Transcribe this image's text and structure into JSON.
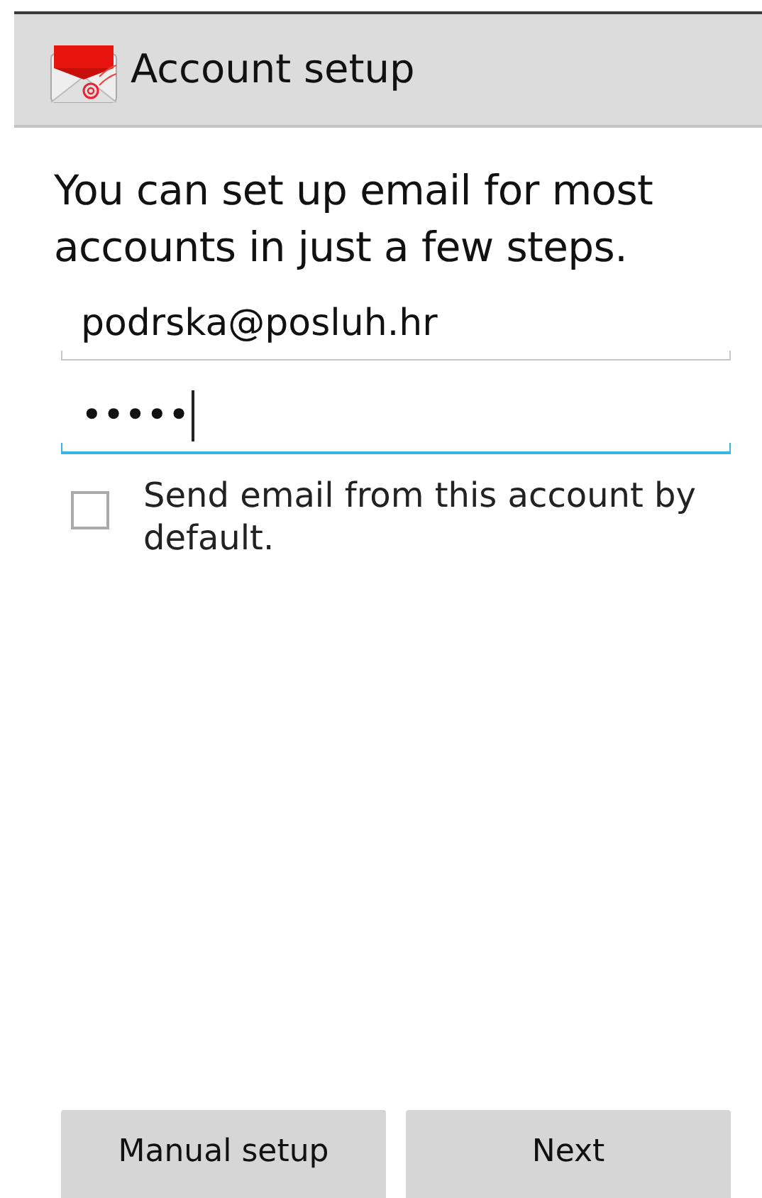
{
  "action_bar": {
    "title": "Account setup"
  },
  "intro": "You can set up email for most accounts in just a few steps.",
  "email_field": {
    "value": "podrska@posluh.hr",
    "focused": false
  },
  "password_field": {
    "value": "•••••",
    "focused": true
  },
  "default_account": {
    "label": "Send email from this account by default.",
    "checked": false
  },
  "buttons": [
    {
      "label": "Manual setup"
    },
    {
      "label": "Next"
    }
  ]
}
